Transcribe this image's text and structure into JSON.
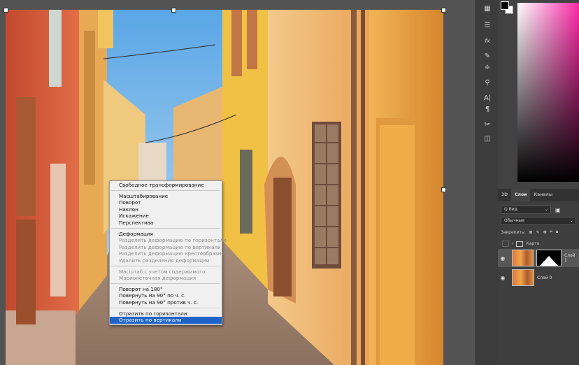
{
  "context_menu": {
    "items": [
      {
        "label": "Свободное трансформирование",
        "state": "normal"
      },
      {
        "sep": true
      },
      {
        "label": "Масштабирование",
        "state": "normal"
      },
      {
        "label": "Поворот",
        "state": "normal"
      },
      {
        "label": "Наклон",
        "state": "normal"
      },
      {
        "label": "Искажение",
        "state": "normal"
      },
      {
        "label": "Перспектива",
        "state": "normal"
      },
      {
        "sep": true
      },
      {
        "label": "Деформация",
        "state": "normal"
      },
      {
        "label": "Разделить деформацию по горизонтали",
        "state": "disabled"
      },
      {
        "label": "Разделить деформацию по вертикали",
        "state": "disabled"
      },
      {
        "label": "Разделить деформацию крестообразно",
        "state": "disabled"
      },
      {
        "label": "Удалить разделения деформации",
        "state": "disabled"
      },
      {
        "sep": true
      },
      {
        "label": "Масштаб с учетом содержимого",
        "state": "disabled"
      },
      {
        "label": "Марионеточная деформация",
        "state": "disabled"
      },
      {
        "sep": true
      },
      {
        "label": "Поворот на 180°",
        "state": "normal"
      },
      {
        "label": "Повернуть на 90° по ч. с.",
        "state": "normal"
      },
      {
        "label": "Повернуть на 90° против ч. с.",
        "state": "normal"
      },
      {
        "sep": true
      },
      {
        "label": "Отразить по горизонтали",
        "state": "normal"
      },
      {
        "label": "Отразить по вертикали",
        "state": "selected"
      }
    ]
  },
  "layers_panel": {
    "tabs": [
      "3D",
      "Слои",
      "Каналы"
    ],
    "active_tab": "Слои",
    "filter_label": "Q Вид",
    "blend_mode": "Обычные",
    "lock_label": "Закрепить:",
    "group_name": "Карта",
    "layers": [
      {
        "name": "Слой 1",
        "has_mask": true
      },
      {
        "name": "Слой 0",
        "has_mask": false
      }
    ]
  },
  "tool_icons": [
    "histogram-icon",
    "properties-icon",
    "fx-icon",
    "brush-icon",
    "adjust-icon",
    "stamp-icon",
    "type-icon",
    "paragraph-icon",
    "transform-icon",
    "frame-icon"
  ]
}
